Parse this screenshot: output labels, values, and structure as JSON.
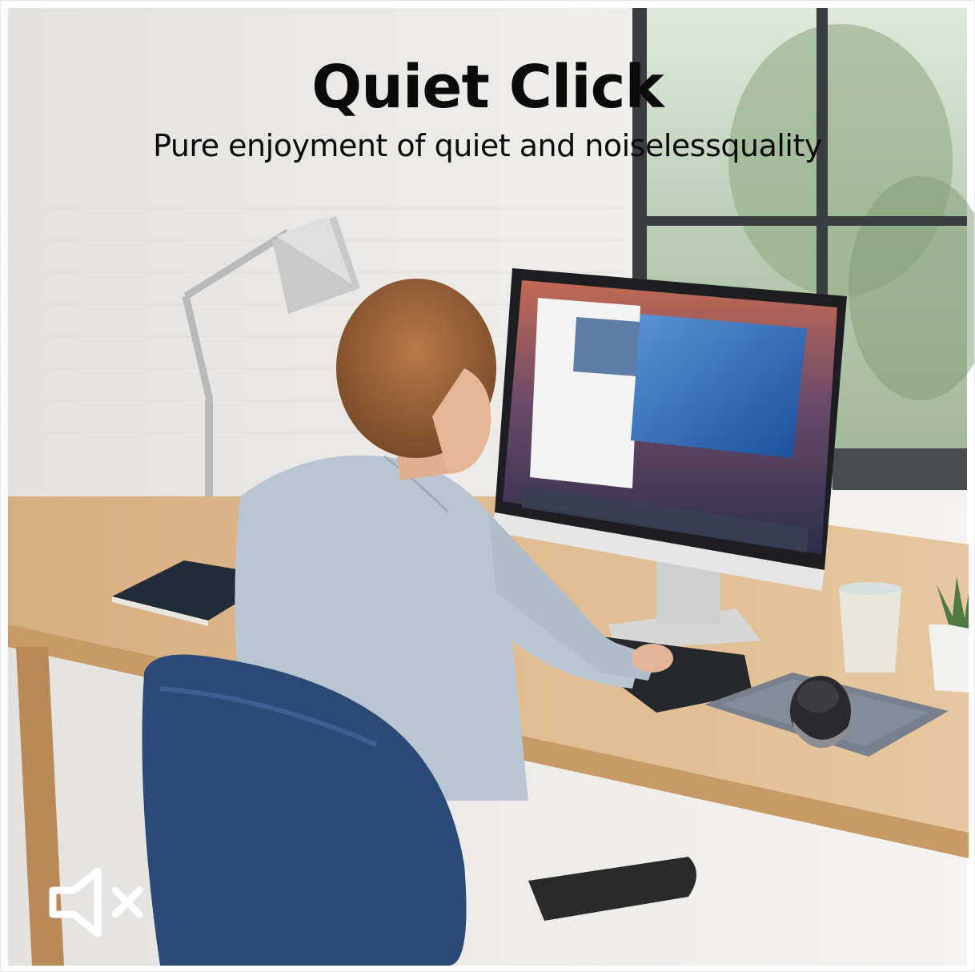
{
  "headline": {
    "title": "Quiet Click",
    "subtitle": "Pure enjoyment of quiet and noiselessquality"
  },
  "badge": {
    "icon": "mute-speaker-icon"
  },
  "colors": {
    "wall": "#eceae6",
    "desk": "#d9b488",
    "chair": "#2c4a78",
    "shirt": "#b9c6d2"
  }
}
